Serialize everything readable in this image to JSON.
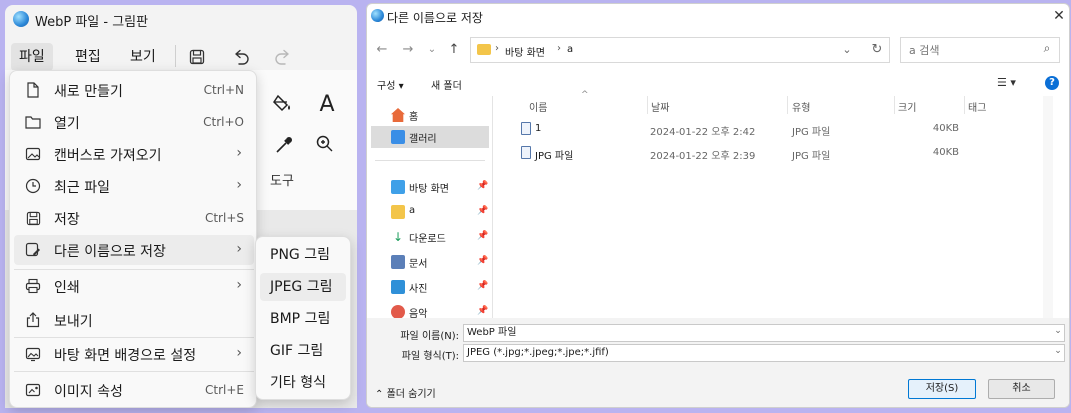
{
  "colors": {
    "desktop_bg": "#b9b3f0",
    "accent": "#0078d4",
    "menu_highlight": "#ececec"
  },
  "paint": {
    "title": "WebP 파일 - 그림판",
    "menubar": {
      "file": "파일",
      "edit": "편집",
      "view": "보기"
    },
    "ribbon": {
      "tools_label": "도구"
    },
    "file_menu": {
      "items": [
        {
          "label": "새로 만들기",
          "shortcut": "Ctrl+N",
          "icon": "new-file-icon"
        },
        {
          "label": "열기",
          "shortcut": "Ctrl+O",
          "icon": "folder-icon"
        },
        {
          "label": "캔버스로 가져오기",
          "shortcut": "",
          "icon": "import-image-icon"
        },
        {
          "label": "최근 파일",
          "shortcut": "",
          "icon": "clock-icon"
        },
        {
          "label": "저장",
          "shortcut": "Ctrl+S",
          "icon": "save-icon"
        },
        {
          "label": "다른 이름으로 저장",
          "shortcut": "",
          "icon": "save-as-icon"
        },
        {
          "label": "인쇄",
          "shortcut": "",
          "icon": "print-icon"
        },
        {
          "label": "보내기",
          "shortcut": "",
          "icon": "share-icon"
        },
        {
          "label": "바탕 화면 배경으로 설정",
          "shortcut": "",
          "icon": "wallpaper-icon"
        },
        {
          "label": "이미지 속성",
          "shortcut": "Ctrl+E",
          "icon": "properties-icon"
        }
      ]
    },
    "save_as_submenu": [
      "PNG 그림",
      "JPEG 그림",
      "BMP 그림",
      "GIF 그림",
      "기타 형식"
    ]
  },
  "dialog": {
    "title": "다른 이름으로 저장",
    "breadcrumb": [
      "바탕 화면",
      "a"
    ],
    "search_placeholder": "a 검색",
    "toolbar": {
      "organize": "구성 ▾",
      "new_folder": "새 폴더"
    },
    "nav": [
      {
        "label": "홈",
        "pinned": false
      },
      {
        "label": "갤러리",
        "pinned": false
      },
      {
        "label": "바탕 화면",
        "pinned": true
      },
      {
        "label": "a",
        "pinned": true
      },
      {
        "label": "다운로드",
        "pinned": true
      },
      {
        "label": "문서",
        "pinned": true
      },
      {
        "label": "사진",
        "pinned": true
      },
      {
        "label": "음악",
        "pinned": true
      }
    ],
    "columns": {
      "name": "이름",
      "date": "날짜",
      "type": "유형",
      "size": "크기",
      "tags": "태그"
    },
    "files": [
      {
        "name": "1",
        "date": "2024-01-22 오후 2:42",
        "type": "JPG 파일",
        "size": "40KB"
      },
      {
        "name": "JPG 파일",
        "date": "2024-01-22 오후 2:39",
        "type": "JPG 파일",
        "size": "40KB"
      }
    ],
    "filename_label": "파일 이름(N):",
    "filename_value": "WebP 파일",
    "filetype_label": "파일 형식(T):",
    "filetype_value": "JPEG (*.jpg;*.jpeg;*.jpe;*.jfif)",
    "hide_folders": "폴더 숨기기",
    "save_button": "저장(S)",
    "cancel_button": "취소"
  }
}
